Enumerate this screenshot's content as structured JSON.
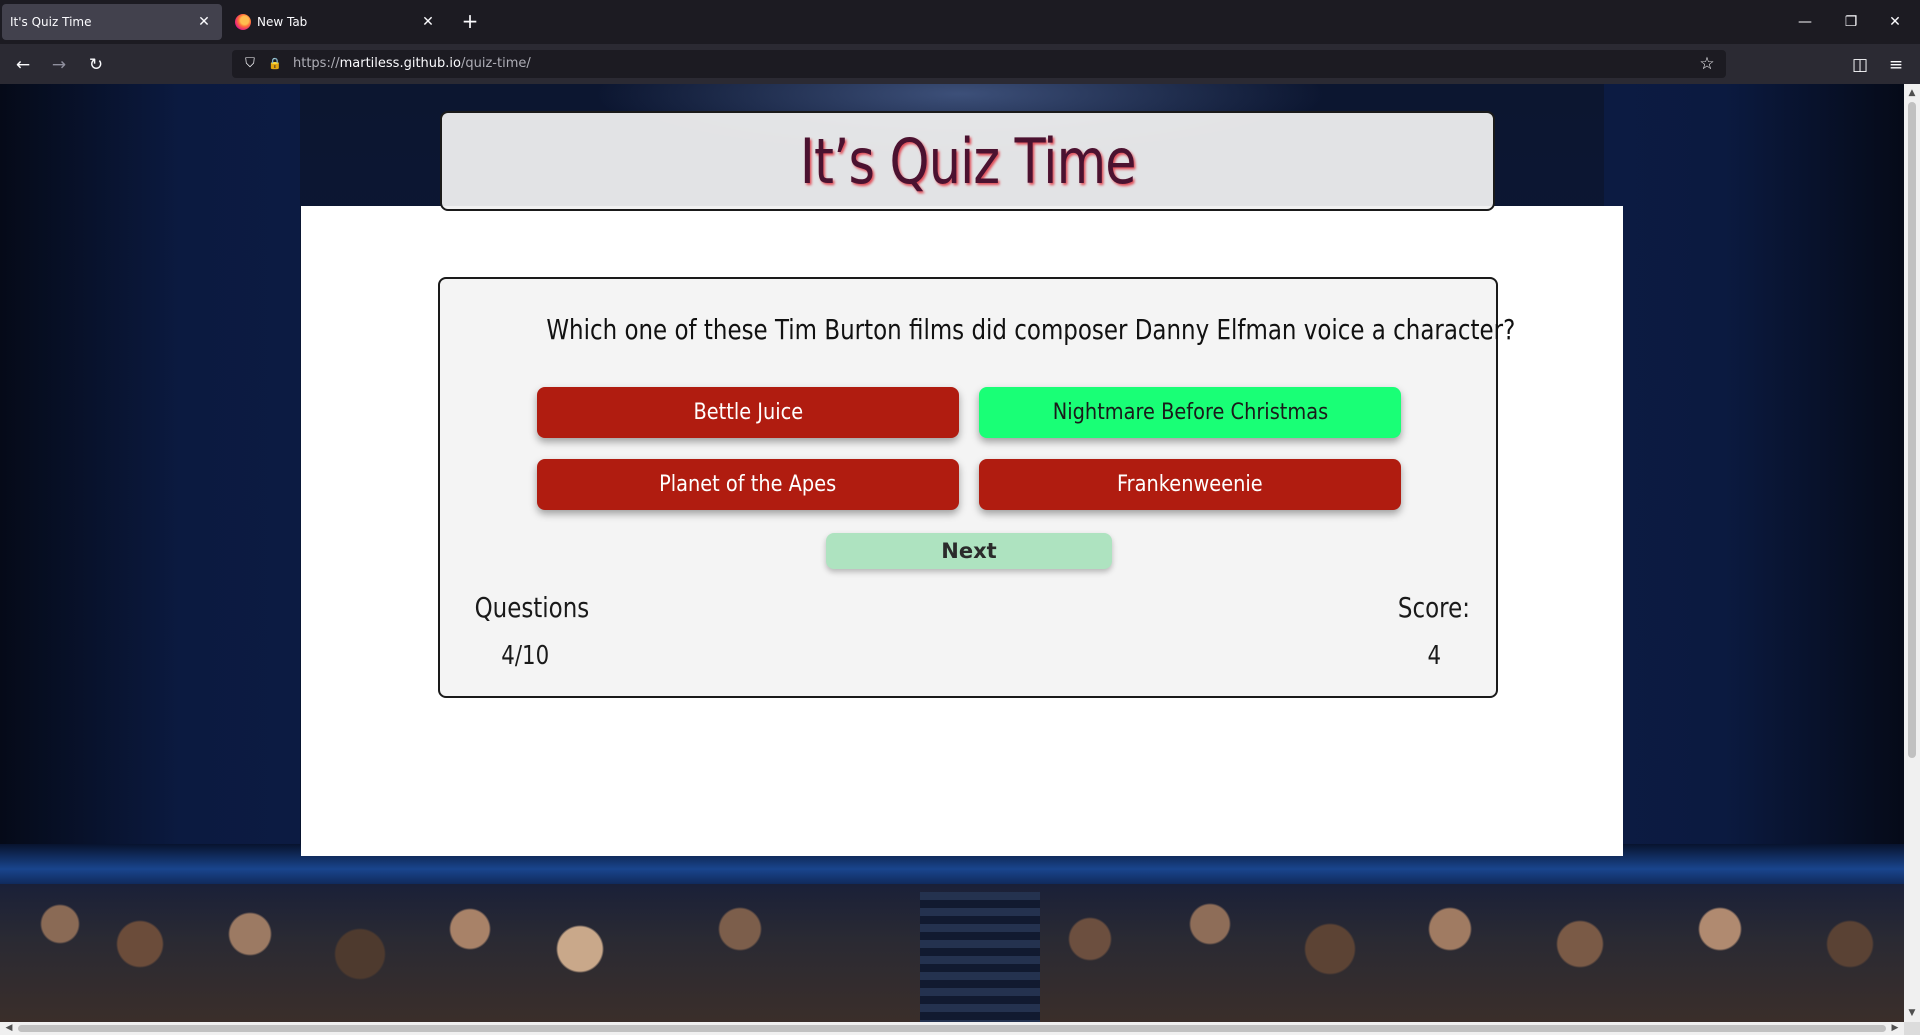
{
  "browser": {
    "tabs": [
      {
        "title": "It's Quiz Time",
        "active": true
      },
      {
        "title": "New Tab",
        "active": false
      }
    ],
    "new_tab_symbol": "+",
    "close_symbol": "✕",
    "url_prefix": "https://",
    "url_host": "martiless.github.io",
    "url_path": "/quiz-time/",
    "icons": {
      "back": "←",
      "forward": "→",
      "reload": "↻",
      "shield": "⛉",
      "lock": "🔒",
      "star": "☆",
      "pocket": "◫",
      "menu": "≡",
      "minimize": "—",
      "restore": "❐",
      "close": "✕"
    }
  },
  "page": {
    "title": "It’s Quiz Time",
    "question": "Which one of these Tim Burton films did composer Danny Elfman voice a character?",
    "answers": [
      {
        "label": "Bettle Juice",
        "correct": false
      },
      {
        "label": "Nightmare Before Christmas",
        "correct": true
      },
      {
        "label": "Planet of the Apes",
        "correct": false
      },
      {
        "label": "Frankenweenie",
        "correct": false
      }
    ],
    "next_label": "Next",
    "questions_label": "Questions",
    "questions_value": "4/10",
    "score_label": "Score:",
    "score_value": "4"
  },
  "colors": {
    "answer_default": "#b01c10",
    "answer_correct": "#19ff76",
    "next_button": "#aee3c0",
    "title_text": "#4b1230"
  }
}
